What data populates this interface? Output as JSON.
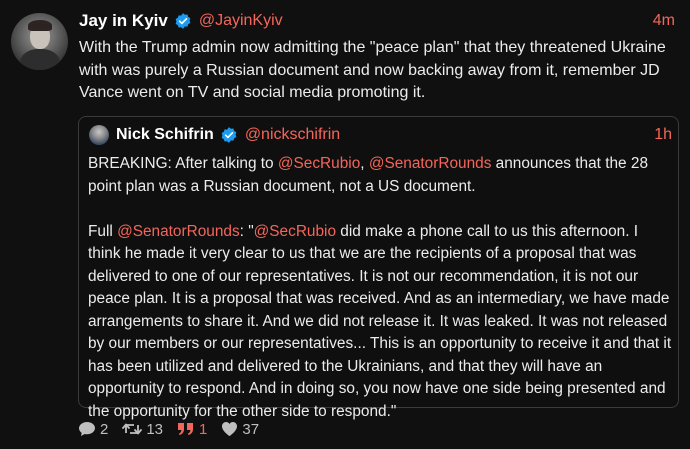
{
  "post": {
    "author_name": "Jay in Kyiv",
    "author_handle": "@JayinKyiv",
    "time": "4m",
    "text": "With the Trump admin now admitting the \"peace plan\" that they threatened Ukraine with was purely a Russian document and now backing away from it, remember JD Vance went on TV and social media promoting it."
  },
  "quote": {
    "author_name": "Nick Schifrin",
    "author_handle": "@nickschifrin",
    "time": "1h",
    "p1": {
      "a": "BREAKING: After talking to ",
      "m1": "@SecRubio",
      "b": ", ",
      "m2": "@SenatorRounds",
      "c": " announces that the 28 point plan was a Russian document, not a US document."
    },
    "p2": {
      "a": "Full ",
      "m1": "@SenatorRounds",
      "b": ": \"",
      "m2": "@SecRubio",
      "c": " did make a phone call to us this afternoon. I think he made it very clear to us that we are the recipients of a proposal that was delivered to one of our representatives. It is not our recommendation, it is not our peace plan. It is a proposal that was received. And as an intermediary, we have made arrangements to share it. And we did not release it. It was leaked. It was not released by our members or our representatives... This is an opportunity to receive it and that it has been utilized and delivered to the Ukrainians, and that they will have an opportunity to respond. And in doing so, you now have one side being presented and the opportunity for the other side to respond.\""
    }
  },
  "stats": {
    "replies": "2",
    "reposts": "13",
    "quotes": "1",
    "likes": "37"
  },
  "icons": {
    "verified": "verified-badge-icon",
    "reply": "speech-bubble-icon",
    "repost": "repost-arrows-icon",
    "quote": "quote-marks-icon",
    "like": "heart-icon"
  },
  "colors": {
    "accent": "#f4665b",
    "verified": "#1d9bf0",
    "background": "#101010"
  }
}
